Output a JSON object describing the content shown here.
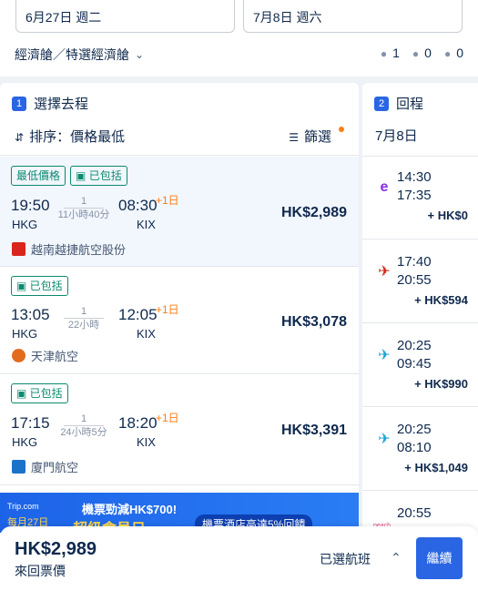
{
  "search": {
    "depart_date": "6月27日 週二",
    "return_date": "7月8日 週六",
    "cabin": "經濟艙／特選經濟艙",
    "adults": "1",
    "children": "0",
    "infants": "0"
  },
  "outbound": {
    "step": "1",
    "title": "選擇去程",
    "sort_label": "排序：價格最低",
    "filter_label": "篩選",
    "flights": [
      {
        "tags": [
          "最低價格",
          "已包括"
        ],
        "dep_time": "19:50",
        "dep_ap": "HKG",
        "stops": "1",
        "duration": "11小時40分",
        "arr_time": "08:30",
        "day_offset": "+1日",
        "arr_ap": "KIX",
        "price": "HK$2,989",
        "airline": "越南越捷航空股份",
        "logo_color": "#d9251d"
      },
      {
        "tags": [
          "已包括"
        ],
        "dep_time": "13:05",
        "dep_ap": "HKG",
        "stops": "1",
        "duration": "22小時",
        "arr_time": "12:05",
        "day_offset": "+1日",
        "arr_ap": "KIX",
        "price": "HK$3,078",
        "airline": "天津航空",
        "logo_color": "#e36b1e"
      },
      {
        "tags": [
          "已包括"
        ],
        "dep_time": "17:15",
        "dep_ap": "HKG",
        "stops": "1",
        "duration": "24小時5分",
        "arr_time": "18:20",
        "day_offset": "+1日",
        "arr_ap": "KIX",
        "price": "HK$3,391",
        "airline": "廈門航空",
        "logo_color": "#1a73c9"
      }
    ],
    "banner": {
      "brand": "Trip.com",
      "promo_left": "機票勁減HK$700!",
      "promo_sub": "超級會員日",
      "promo_right": "機票酒店高達5%回饋",
      "date": "每月27日"
    }
  },
  "inbound": {
    "step": "2",
    "title": "回程",
    "date": "7月8日",
    "flights": [
      {
        "dep": "14:30",
        "arr": "17:35",
        "price": "+ HK$0",
        "logo": "e",
        "logo_color": "#8a2be2"
      },
      {
        "dep": "17:40",
        "arr": "20:55",
        "price": "+ HK$594",
        "logo": "✈",
        "logo_color": "#d9251d"
      },
      {
        "dep": "20:25",
        "arr": "09:45",
        "price": "+ HK$990",
        "logo": "✈",
        "logo_color": "#1aa6d6"
      },
      {
        "dep": "20:25",
        "arr": "08:10",
        "price": "+ HK$1,049",
        "logo": "✈",
        "logo_color": "#1aa6d6"
      },
      {
        "dep": "20:55",
        "arr": "",
        "price": "",
        "logo": "peach",
        "logo_color": "#e04b8a"
      }
    ]
  },
  "footer": {
    "total_price": "HK$2,989",
    "price_label": "來回票價",
    "selected_label": "已選航班",
    "continue_label": "繼續"
  }
}
